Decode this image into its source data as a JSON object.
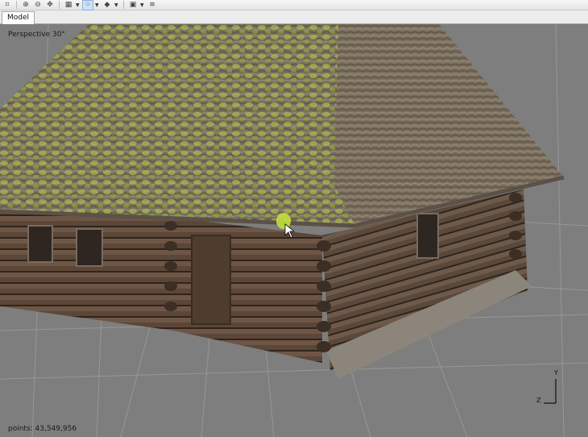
{
  "toolbar": {
    "buttons": [
      {
        "icon": "crop-icon",
        "glyph": "⌗"
      },
      {
        "icon": "zoom-in-icon",
        "glyph": "⊕"
      },
      {
        "icon": "zoom-out-icon",
        "glyph": "⊖"
      },
      {
        "icon": "move-icon",
        "glyph": "✥"
      },
      {
        "icon": "grid-icon",
        "glyph": "▦"
      },
      {
        "icon": "point-cloud-icon",
        "glyph": "⁘"
      },
      {
        "icon": "shape-icon",
        "glyph": "◆"
      },
      {
        "icon": "image-icon",
        "glyph": "▣"
      },
      {
        "icon": "list-icon",
        "glyph": "≡"
      }
    ]
  },
  "tabs": {
    "active_label": "Model"
  },
  "viewport": {
    "view_label": "Perspective 30°",
    "points_label": "points: 43,549,956",
    "axis_y": "Y",
    "axis_z": "Z"
  },
  "colors": {
    "background": "#7e7e7e",
    "grid_line": "#9a9a9a",
    "roof": "#7b6f5e",
    "moss": "#a9c34a",
    "logs": "#5c4637",
    "marker": "#c3df3f"
  }
}
